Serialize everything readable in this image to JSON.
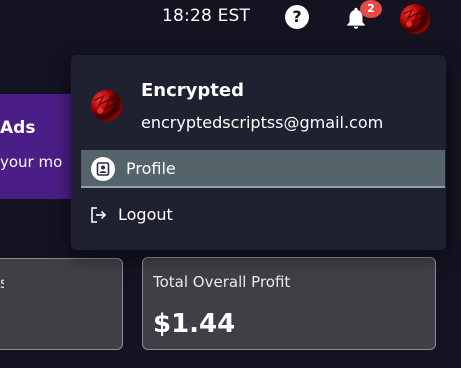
{
  "header": {
    "time": "18:28 EST",
    "help_icon": "question-circle-icon",
    "bell_icon": "bell-icon",
    "notification_count": "2"
  },
  "promo": {
    "title": "Ads",
    "subtitle": "your mo"
  },
  "stats": {
    "left_label": "s",
    "right_label": "Total Overall Profit",
    "right_value": "$1.44"
  },
  "user_menu": {
    "name": "Encrypted",
    "email": "encryptedscriptss@gmail.com",
    "items": [
      {
        "label": "Profile",
        "icon": "profile-icon"
      },
      {
        "label": "Logout",
        "icon": "logout-icon"
      }
    ]
  },
  "colors": {
    "background": "#131322",
    "dropdown": "#1f2030",
    "highlight": "#55636b",
    "promo": "#4b1e87",
    "badge": "#e84a4a",
    "card": "#3f4046"
  }
}
